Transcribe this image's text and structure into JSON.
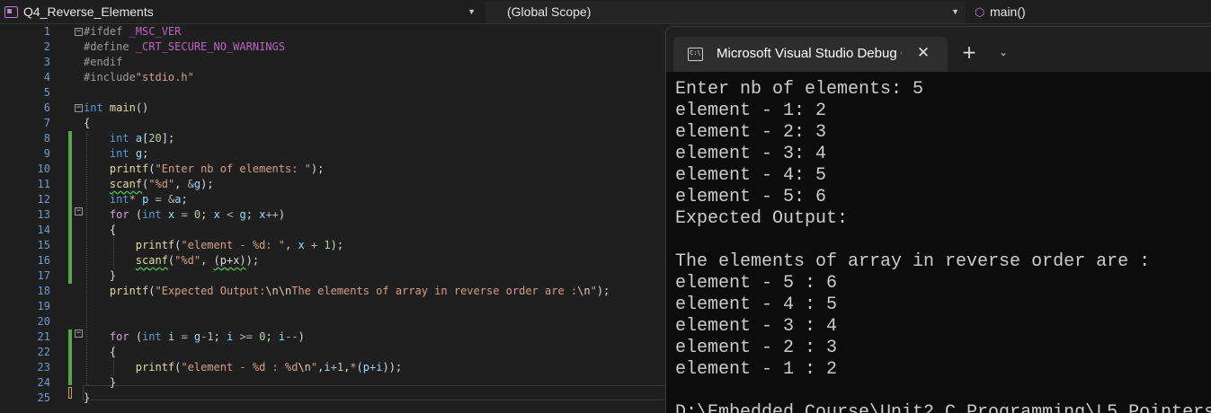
{
  "navbar": {
    "project": "Q4_Reverse_Elements",
    "scope": "(Global Scope)",
    "function": "main()"
  },
  "editor": {
    "line_numbers": [
      "1",
      "2",
      "3",
      "4",
      "5",
      "6",
      "7",
      "8",
      "9",
      "10",
      "11",
      "12",
      "13",
      "14",
      "15",
      "16",
      "17",
      "18",
      "19",
      "20",
      "21",
      "22",
      "23",
      "24",
      "25"
    ],
    "lines": [
      [
        {
          "c": "pp",
          "t": "#ifdef "
        },
        {
          "c": "mac",
          "t": "_MSC_VER"
        }
      ],
      [
        {
          "c": "pp",
          "t": "#define "
        },
        {
          "c": "mac",
          "t": "_CRT_SECURE_NO_WARNINGS"
        }
      ],
      [
        {
          "c": "pp",
          "t": "#endif"
        }
      ],
      [
        {
          "c": "pp",
          "t": "#include"
        },
        {
          "c": "str",
          "t": "\"stdio.h\""
        }
      ],
      [],
      [
        {
          "c": "kw",
          "t": "int"
        },
        {
          "c": "",
          "t": " "
        },
        {
          "c": "fn",
          "t": "main"
        },
        {
          "c": "",
          "t": "()"
        }
      ],
      [
        {
          "c": "",
          "t": "{"
        }
      ],
      [
        {
          "c": "",
          "t": "    "
        },
        {
          "c": "kw",
          "t": "int"
        },
        {
          "c": "",
          "t": " "
        },
        {
          "c": "var",
          "t": "a"
        },
        {
          "c": "",
          "t": "["
        },
        {
          "c": "num",
          "t": "20"
        },
        {
          "c": "",
          "t": "];"
        }
      ],
      [
        {
          "c": "",
          "t": "    "
        },
        {
          "c": "kw",
          "t": "int"
        },
        {
          "c": "",
          "t": " "
        },
        {
          "c": "var",
          "t": "g"
        },
        {
          "c": "",
          "t": ";"
        }
      ],
      [
        {
          "c": "",
          "t": "    "
        },
        {
          "c": "fn",
          "t": "printf"
        },
        {
          "c": "",
          "t": "("
        },
        {
          "c": "str",
          "t": "\"Enter nb of elements: \""
        },
        {
          "c": "",
          "t": ");"
        }
      ],
      [
        {
          "c": "",
          "t": "    "
        },
        {
          "c": "fn squig",
          "t": "scanf"
        },
        {
          "c": "",
          "t": "("
        },
        {
          "c": "str",
          "t": "\"%d\""
        },
        {
          "c": "",
          "t": ", "
        },
        {
          "c": "op",
          "t": "&"
        },
        {
          "c": "var",
          "t": "g"
        },
        {
          "c": "",
          "t": ");"
        }
      ],
      [
        {
          "c": "",
          "t": "    "
        },
        {
          "c": "kw",
          "t": "int"
        },
        {
          "c": "op",
          "t": "*"
        },
        {
          "c": "",
          "t": " "
        },
        {
          "c": "var",
          "t": "p"
        },
        {
          "c": "",
          "t": " "
        },
        {
          "c": "op",
          "t": "="
        },
        {
          "c": "",
          "t": " "
        },
        {
          "c": "op",
          "t": "&"
        },
        {
          "c": "var",
          "t": "a"
        },
        {
          "c": "",
          "t": ";"
        }
      ],
      [
        {
          "c": "",
          "t": "    "
        },
        {
          "c": "ctl",
          "t": "for"
        },
        {
          "c": "",
          "t": " ("
        },
        {
          "c": "kw",
          "t": "int"
        },
        {
          "c": "",
          "t": " "
        },
        {
          "c": "var",
          "t": "x"
        },
        {
          "c": "",
          "t": " "
        },
        {
          "c": "op",
          "t": "="
        },
        {
          "c": "",
          "t": " "
        },
        {
          "c": "num",
          "t": "0"
        },
        {
          "c": "",
          "t": "; "
        },
        {
          "c": "var",
          "t": "x"
        },
        {
          "c": "",
          "t": " "
        },
        {
          "c": "op",
          "t": "<"
        },
        {
          "c": "",
          "t": " "
        },
        {
          "c": "var",
          "t": "g"
        },
        {
          "c": "",
          "t": "; "
        },
        {
          "c": "var",
          "t": "x"
        },
        {
          "c": "op",
          "t": "++"
        },
        {
          "c": "",
          "t": ")"
        }
      ],
      [
        {
          "c": "",
          "t": "    {"
        }
      ],
      [
        {
          "c": "",
          "t": "        "
        },
        {
          "c": "fn",
          "t": "printf"
        },
        {
          "c": "",
          "t": "("
        },
        {
          "c": "str",
          "t": "\"element - %d: \""
        },
        {
          "c": "",
          "t": ", "
        },
        {
          "c": "var",
          "t": "x"
        },
        {
          "c": "",
          "t": " "
        },
        {
          "c": "op",
          "t": "+"
        },
        {
          "c": "",
          "t": " "
        },
        {
          "c": "num",
          "t": "1"
        },
        {
          "c": "",
          "t": ");"
        }
      ],
      [
        {
          "c": "",
          "t": "        "
        },
        {
          "c": "fn squig",
          "t": "scanf"
        },
        {
          "c": "",
          "t": "("
        },
        {
          "c": "str",
          "t": "\"%d\""
        },
        {
          "c": "",
          "t": ", "
        },
        {
          "c": "squig",
          "t": "(p+x)"
        },
        {
          "c": "",
          "t": ");"
        }
      ],
      [
        {
          "c": "",
          "t": "    }"
        }
      ],
      [
        {
          "c": "",
          "t": "    "
        },
        {
          "c": "fn",
          "t": "printf"
        },
        {
          "c": "",
          "t": "("
        },
        {
          "c": "str",
          "t": "\"Expected Output:"
        },
        {
          "c": "esc",
          "t": "\\n\\n"
        },
        {
          "c": "str",
          "t": "The elements of array in reverse order are :"
        },
        {
          "c": "esc",
          "t": "\\n"
        },
        {
          "c": "str",
          "t": "\""
        },
        {
          "c": "",
          "t": ");"
        }
      ],
      [],
      [],
      [
        {
          "c": "",
          "t": "    "
        },
        {
          "c": "ctl",
          "t": "for"
        },
        {
          "c": "",
          "t": " ("
        },
        {
          "c": "kw",
          "t": "int"
        },
        {
          "c": "",
          "t": " "
        },
        {
          "c": "var",
          "t": "i"
        },
        {
          "c": "",
          "t": " "
        },
        {
          "c": "op",
          "t": "="
        },
        {
          "c": "",
          "t": " "
        },
        {
          "c": "var",
          "t": "g"
        },
        {
          "c": "op",
          "t": "-"
        },
        {
          "c": "num",
          "t": "1"
        },
        {
          "c": "",
          "t": "; "
        },
        {
          "c": "var",
          "t": "i"
        },
        {
          "c": "",
          "t": " "
        },
        {
          "c": "op",
          "t": ">="
        },
        {
          "c": "",
          "t": " "
        },
        {
          "c": "num",
          "t": "0"
        },
        {
          "c": "",
          "t": "; "
        },
        {
          "c": "var",
          "t": "i"
        },
        {
          "c": "op",
          "t": "--"
        },
        {
          "c": "",
          "t": ")"
        }
      ],
      [
        {
          "c": "",
          "t": "    {"
        }
      ],
      [
        {
          "c": "",
          "t": "        "
        },
        {
          "c": "fn",
          "t": "printf"
        },
        {
          "c": "",
          "t": "("
        },
        {
          "c": "str",
          "t": "\"element - %d : %d"
        },
        {
          "c": "esc",
          "t": "\\n"
        },
        {
          "c": "str",
          "t": "\""
        },
        {
          "c": "",
          "t": ","
        },
        {
          "c": "var",
          "t": "i"
        },
        {
          "c": "op",
          "t": "+"
        },
        {
          "c": "num",
          "t": "1"
        },
        {
          "c": "",
          "t": ","
        },
        {
          "c": "op",
          "t": "*"
        },
        {
          "c": "",
          "t": "("
        },
        {
          "c": "var",
          "t": "p"
        },
        {
          "c": "op",
          "t": "+"
        },
        {
          "c": "var",
          "t": "i"
        },
        {
          "c": "",
          "t": "));"
        }
      ],
      [
        {
          "c": "",
          "t": "    }"
        }
      ],
      [
        {
          "c": "",
          "t": "}"
        }
      ]
    ]
  },
  "console": {
    "tab_title": "Microsoft Visual Studio Debug Console",
    "tab_icon_text": "C:\\",
    "close_glyph": "✕",
    "new_tab_glyph": "+",
    "menu_glyph": "⌄",
    "output": [
      "Enter nb of elements: 5",
      "element - 1: 2",
      "element - 2: 3",
      "element - 3: 4",
      "element - 4: 5",
      "element - 5: 6",
      "Expected Output:",
      "",
      "The elements of array in reverse order are :",
      "element - 5 : 6",
      "element - 4 : 5",
      "element - 3 : 4",
      "element - 2 : 3",
      "element - 1 : 2",
      "",
      "D:\\Embedded Course\\Unit2 C Programming\\L5 Pointers"
    ]
  },
  "colors": {
    "editor_bg": "#1f1f1f",
    "console_bg": "#0c0c0c",
    "line_number": "#6e9ccf",
    "keyword": "#569cd6",
    "string": "#d69d85",
    "function": "#dcdcaa",
    "change_bar": "#57a64a"
  }
}
